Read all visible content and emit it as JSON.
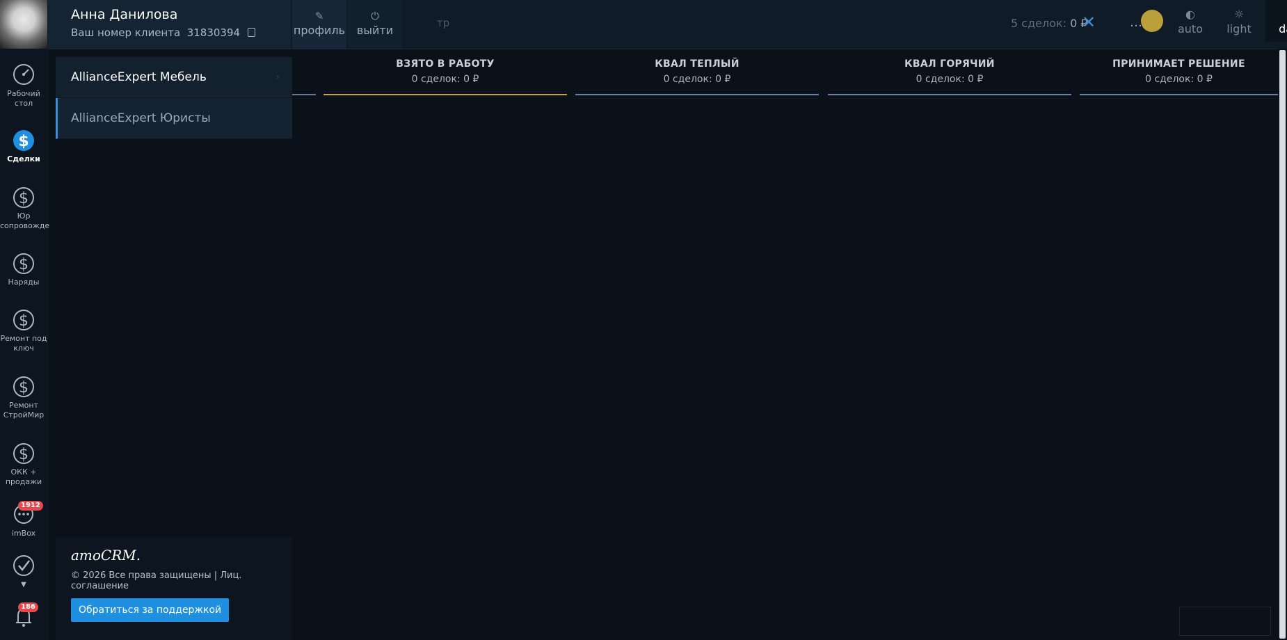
{
  "profile": {
    "name": "Анна Данилова",
    "client_label": "Ваш номер клиента",
    "client_number": "31830394",
    "profile_btn": "профиль",
    "logout_btn": "выйти"
  },
  "header": {
    "search_placeholder_fragment": "тр",
    "deals_count": "5 сделок:",
    "deals_sum": "0 ₽",
    "more_icon": "…",
    "themes": [
      {
        "label": "auto",
        "icon": "auto-theme-icon"
      },
      {
        "label": "light",
        "icon": "sun-icon"
      },
      {
        "label": "dark",
        "icon": "moon-icon"
      }
    ]
  },
  "nav": {
    "items": [
      {
        "label": "Рабочий стол",
        "icon": "dashboard-icon"
      },
      {
        "label": "Сделки",
        "icon": "deals-icon",
        "active": true
      },
      {
        "label": "Юр сопровожде",
        "icon": "dollar-icon"
      },
      {
        "label": "Наряды",
        "icon": "dollar-icon"
      },
      {
        "label": "Ремонт под ключ",
        "icon": "dollar-icon"
      },
      {
        "label": "Ремонт СтройМир",
        "icon": "dollar-icon"
      },
      {
        "label": "ОКК + продажи",
        "icon": "dollar-icon"
      },
      {
        "label": "imBox",
        "icon": "chat-icon",
        "badge": "1912"
      },
      {
        "label": "",
        "icon": "tasks-check-icon"
      },
      {
        "label": "",
        "icon": "bell-icon",
        "badge": "186"
      }
    ]
  },
  "dropdown": {
    "items": [
      {
        "label": "AllianceExpert Мебель"
      },
      {
        "label": "AllianceExpert Юристы"
      }
    ]
  },
  "footer": {
    "logo": "amoCRM.",
    "copyright": "© 2026 Все права защищены | Лиц. соглашение",
    "support": "Обратиться за поддержкой"
  },
  "pipeline": {
    "columns": [
      {
        "title": "ВЗЯТО В РАБОТУ",
        "summary": "0 сделок: 0 ₽",
        "color": "#c9a13a"
      },
      {
        "title": "КВАЛ ТЕПЛЫЙ",
        "summary": "0 сделок: 0 ₽",
        "color": "#6b7fa8"
      },
      {
        "title": "КВАЛ ГОРЯЧИЙ",
        "summary": "0 сделок: 0 ₽",
        "color": "#6b7fa8"
      },
      {
        "title": "ПРИНИМАЕТ РЕШЕНИЕ",
        "summary": "0 сделок: 0 ₽",
        "color": "#6b7fa8"
      }
    ]
  },
  "colors": {
    "accent": "#1f8fe0",
    "badge": "#e5484d",
    "background": "#0b1118"
  }
}
